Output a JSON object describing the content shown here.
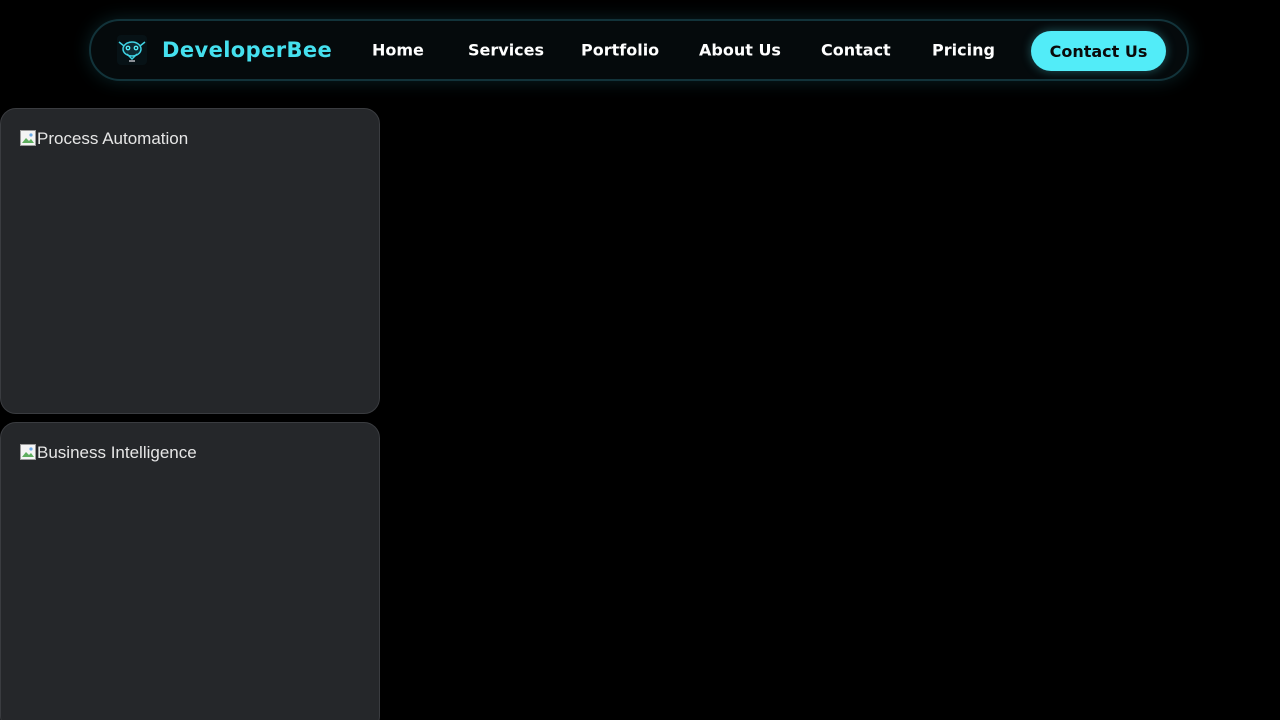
{
  "header": {
    "brand_name": "DeveloperBee",
    "logo_icon": "bee-robot-logo-icon",
    "accent_color": "#52ecf8",
    "nav_items": [
      {
        "label": "Home"
      },
      {
        "label": "Services"
      },
      {
        "label": "Portfolio"
      },
      {
        "label": "About Us"
      },
      {
        "label": "Contact"
      },
      {
        "label": "Pricing"
      }
    ],
    "cta_label": "Contact Us"
  },
  "cards": [
    {
      "image_alt": "Process Automation",
      "image_icon": "broken-image-icon"
    },
    {
      "image_alt": "Business Intelligence",
      "image_icon": "broken-image-icon"
    }
  ]
}
